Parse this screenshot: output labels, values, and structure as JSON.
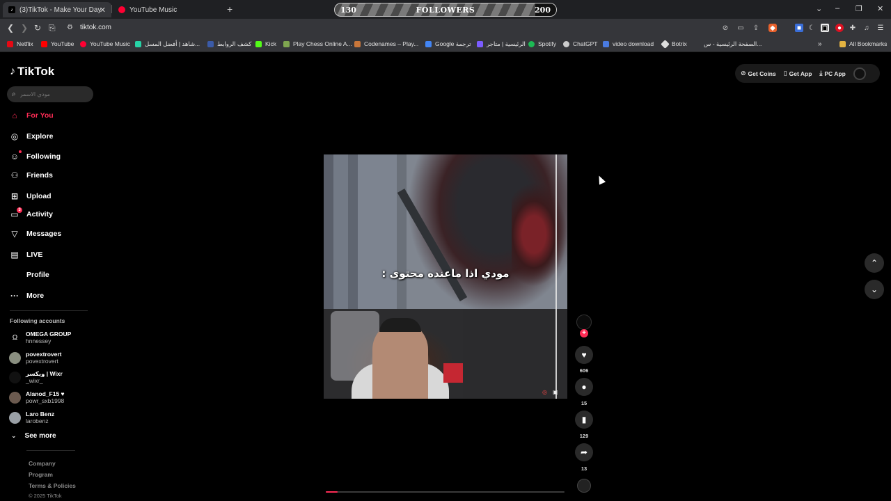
{
  "browser": {
    "tabs": [
      {
        "title": "(3)TikTok - Make Your Day",
        "active": true
      },
      {
        "title": "YouTube Music",
        "active": false
      }
    ],
    "url": "tiktok.com",
    "followers_widget": {
      "min": "130",
      "label": "FOLLOWERS",
      "max": "200",
      "progress": 0.0
    },
    "bookmarks": [
      {
        "label": "Netflix",
        "color": "#e50914"
      },
      {
        "label": "YouTube",
        "color": "#ff0000"
      },
      {
        "label": "YouTube Music",
        "color": "#ff0033"
      },
      {
        "label": "شاهد | أفضل المسل...",
        "color": "#27d3a6"
      },
      {
        "label": "كشف الروابط",
        "color": "#3b5ba8"
      },
      {
        "label": "Kick",
        "color": "#53fc18"
      },
      {
        "label": "Play Chess Online A...",
        "color": "#7fa650"
      },
      {
        "label": "Codenames – Play...",
        "color": "#c8763a"
      },
      {
        "label": "Google ترجمة",
        "color": "#4285f4"
      },
      {
        "label": "الرئيسية | متاجر",
        "color": "#7b5cff"
      },
      {
        "label": "Spotify",
        "color": "#1db954"
      },
      {
        "label": "ChatGPT",
        "color": "#cccccc"
      },
      {
        "label": "video download",
        "color": "#4a7be0"
      },
      {
        "label": "Botrix",
        "color": "#dddddd"
      },
      {
        "label": "الصفحة الرئيسية - س...",
        "color": "#35363a"
      }
    ],
    "all_bookmarks": "All Bookmarks"
  },
  "tiktok": {
    "logo": "TikTok",
    "search_placeholder": "مودي الاسمر",
    "nav": [
      {
        "label": "For You",
        "icon": "home-icon"
      },
      {
        "label": "Explore",
        "icon": "compass-icon"
      },
      {
        "label": "Following",
        "icon": "following-icon"
      },
      {
        "label": "Friends",
        "icon": "friends-icon"
      },
      {
        "label": "Upload",
        "icon": "upload-icon"
      },
      {
        "label": "Activity",
        "icon": "activity-icon",
        "badge": "3"
      },
      {
        "label": "Messages",
        "icon": "messages-icon"
      },
      {
        "label": "LIVE",
        "icon": "live-icon"
      },
      {
        "label": "Profile",
        "icon": "profile-icon"
      },
      {
        "label": "More",
        "icon": "more-icon"
      }
    ],
    "following_accounts_title": "Following accounts",
    "following_accounts": [
      {
        "name": "OMEGA GROUP",
        "handle": "hnnessey"
      },
      {
        "name": "povextrovert",
        "handle": "povextrovert"
      },
      {
        "name": "ويكسر | Wixr",
        "handle": "_wixr_"
      },
      {
        "name": "Alanod_F15 ♥",
        "handle": "powr_sxb1998"
      },
      {
        "name": "Laro Benz",
        "handle": "larobenz"
      }
    ],
    "see_more": "See more",
    "footer": [
      "Company",
      "Program",
      "Terms & Policies"
    ],
    "copyright": "© 2025 TikTok",
    "top_right": {
      "get_coins": "Get Coins",
      "get_app": "Get App",
      "pc_app": "PC App"
    },
    "video": {
      "caption": "مودي اذا ماعنده محتوى :",
      "progress": 0.05
    },
    "actions": {
      "likes": "606",
      "comments": "15",
      "saves": "129",
      "shares": "13"
    }
  }
}
